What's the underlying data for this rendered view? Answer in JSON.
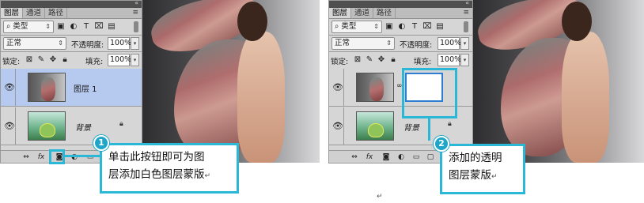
{
  "left": {
    "tabs": [
      "图层",
      "通道",
      "路径"
    ],
    "filter": {
      "label": "类型"
    },
    "blend_mode": "正常",
    "opacity_label": "不透明度:",
    "opacity_value": "100%",
    "lock_label": "锁定:",
    "fill_label": "填充:",
    "fill_value": "100%",
    "layers": [
      {
        "name": "图层 1",
        "selected": true
      },
      {
        "name": "背景",
        "locked": true
      }
    ],
    "step_number": "1",
    "callout": [
      "单击此按钮即可为图",
      "层添加白色图层蒙版"
    ]
  },
  "right": {
    "tabs": [
      "图层",
      "通道",
      "路径"
    ],
    "filter": {
      "label": "类型"
    },
    "blend_mode": "正常",
    "opacity_label": "不透明度:",
    "opacity_value": "100%",
    "lock_label": "锁定:",
    "fill_label": "填充:",
    "fill_value": "100%",
    "layers": [
      {
        "name": "",
        "has_mask": true
      },
      {
        "name": "背景",
        "locked": true
      }
    ],
    "step_number": "2",
    "callout": [
      "添加的透明",
      "图层蒙版"
    ]
  },
  "icons": [
    "eye-icon",
    "lock-icon",
    "link-icon",
    "fx-icon",
    "add-mask-icon",
    "adjustment-icon",
    "folder-icon",
    "new-layer-icon",
    "trash-icon",
    "search-icon"
  ],
  "colors": {
    "accent": "#2bb8d6",
    "badge": "#1ea5c7",
    "selected_layer": "#b6c9ef"
  },
  "symbols": {
    "return_mark": "↵"
  }
}
